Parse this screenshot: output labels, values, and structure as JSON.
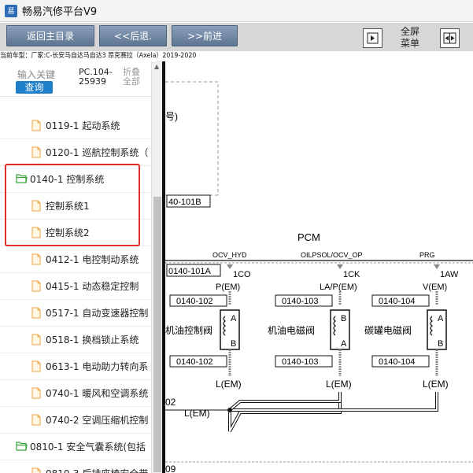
{
  "window": {
    "title": "畅易汽修平台V9",
    "icon_label": "易"
  },
  "toolbar": {
    "home": "返回主目录",
    "back": "<<后退.",
    "forward": ">>前进",
    "fullscreen": "全屏\n菜单"
  },
  "car_info": "当前车型：厂家:C-长安马自达马自达3 昂克赛拉（Axela）2019-2020",
  "search": {
    "placeholder": "输入关键",
    "button": "查询",
    "pc_line1": "PC.104-",
    "pc_line2": "25939",
    "fold_line1": "折叠",
    "fold_line2": "全部"
  },
  "tree": {
    "items": [
      {
        "label": "0119-1 起动系统",
        "type": "file",
        "level": 1
      },
      {
        "label": "0120-1 巡航控制系统（",
        "type": "file",
        "level": 1
      },
      {
        "label": "0140-1 控制系统",
        "type": "folder",
        "level": 0
      },
      {
        "label": "控制系统1",
        "type": "file",
        "level": 1
      },
      {
        "label": "控制系统2",
        "type": "file",
        "level": 1
      },
      {
        "label": "0412-1 电控制动系统",
        "type": "file",
        "level": 1
      },
      {
        "label": "0415-1 动态稳定控制",
        "type": "file",
        "level": 1
      },
      {
        "label": "0517-1 自动变速器控制",
        "type": "file",
        "level": 1
      },
      {
        "label": "0518-1 换档锁止系统",
        "type": "file",
        "level": 1
      },
      {
        "label": "0613-1 电动助力转向系",
        "type": "file",
        "level": 1
      },
      {
        "label": "0740-1 暖风和空调系统",
        "type": "file",
        "level": 1
      },
      {
        "label": "0740-2 空调压缩机控制",
        "type": "file",
        "level": 1
      },
      {
        "label": "0810-1 安全气囊系统(包括",
        "type": "folder",
        "level": 0
      },
      {
        "label": "0810-3 后排座椅安全带",
        "type": "file",
        "level": 1
      }
    ]
  },
  "diagram": {
    "top_text": "号)",
    "ref_top": "40-101B",
    "pcm": "PCM",
    "ref_left": "0140-101A",
    "row_label_left": "02",
    "bottom_text": "09",
    "l_em": "L(EM)",
    "valves": [
      {
        "signal": "OCV_HYD",
        "pin": "1CO",
        "pwr": "P(EM)",
        "ref_top": "0140-102",
        "name": "机油控制阀",
        "ref_bottom": "0140-102",
        "ground": "L(EM)",
        "top_letter": "A",
        "bottom_letter": "B"
      },
      {
        "signal": "OILPSOL/OCV_OP",
        "pin": "1CK",
        "pwr": "LA/P(EM)",
        "ref_top": "0140-103",
        "name": "机油电磁阀",
        "ref_bottom": "0140-103",
        "ground": "L(EM)",
        "top_letter": "B",
        "bottom_letter": "A"
      },
      {
        "signal": "PRG",
        "pin": "1AW",
        "pwr": "V(EM)",
        "ref_top": "0140-104",
        "name": "碳罐电磁阀",
        "ref_bottom": "0140-104",
        "ground": "L(EM)",
        "top_letter": "A",
        "bottom_letter": "B"
      }
    ]
  }
}
